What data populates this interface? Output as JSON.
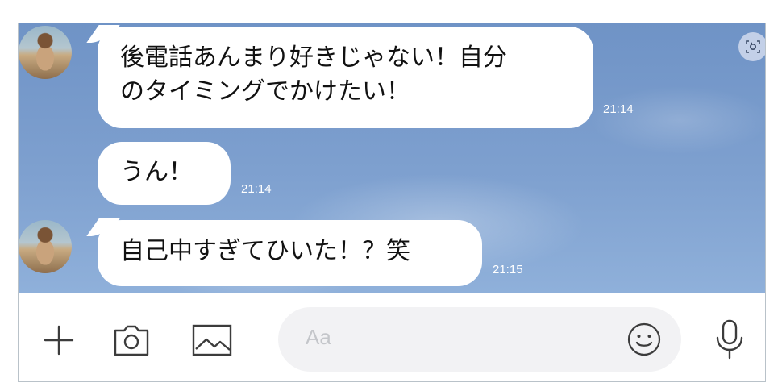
{
  "messages": [
    {
      "lines": [
        "後電話あんまり好きじゃない！自分",
        "のタイミングでかけたい！"
      ],
      "time": "21:14"
    },
    {
      "lines": [
        "うん！"
      ],
      "time": "21:14"
    },
    {
      "lines": [
        "自己中すぎてひいた！？笑"
      ],
      "time": "21:15"
    }
  ],
  "composer": {
    "placeholder": "Aa"
  },
  "icons": {
    "add": "plus-icon",
    "camera": "camera-icon",
    "image": "image-icon",
    "emoji": "smiley-icon",
    "mic": "microphone-icon",
    "scan": "scan-icon"
  }
}
